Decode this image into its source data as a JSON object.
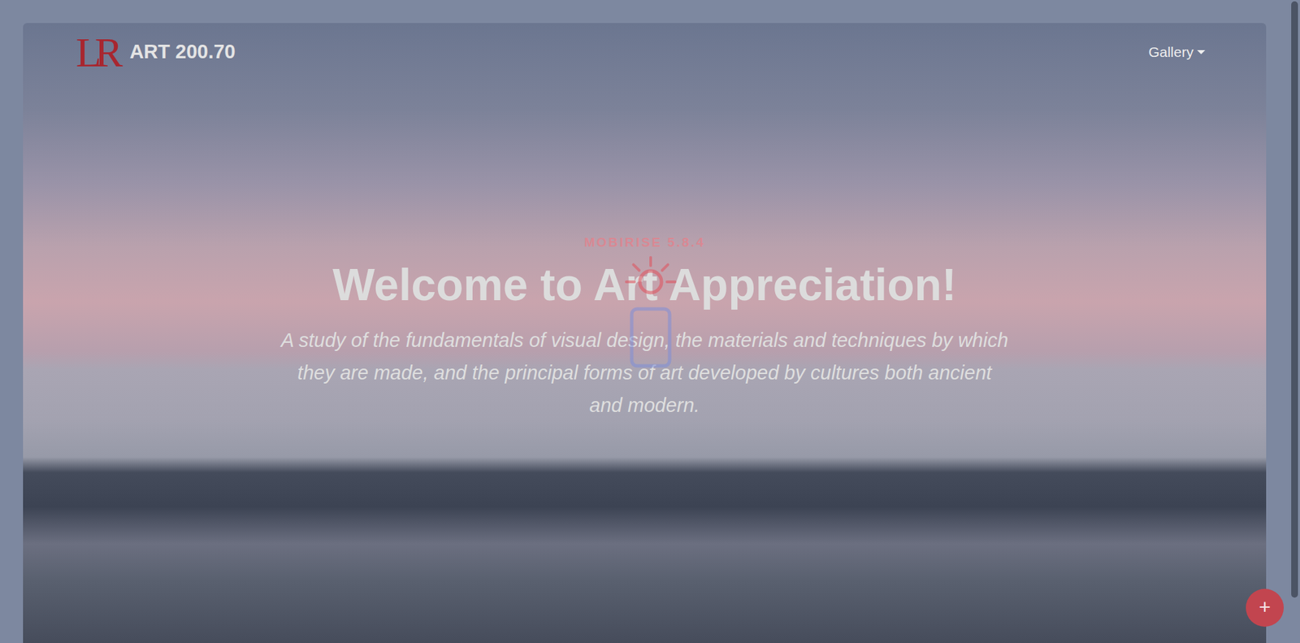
{
  "navbar": {
    "logo": "LR",
    "brand": "ART 200.70",
    "menu": [
      "Gallery"
    ]
  },
  "hero": {
    "label": "MOBIRISE 5.8.4",
    "title": "Welcome to Art Appreciation!",
    "subtitle": "A study of the fundamentals of visual design, the materials and techniques by which they are made, and the principal forms of art developed by cultures both ancient and modern."
  },
  "fab": {
    "label": "+"
  }
}
